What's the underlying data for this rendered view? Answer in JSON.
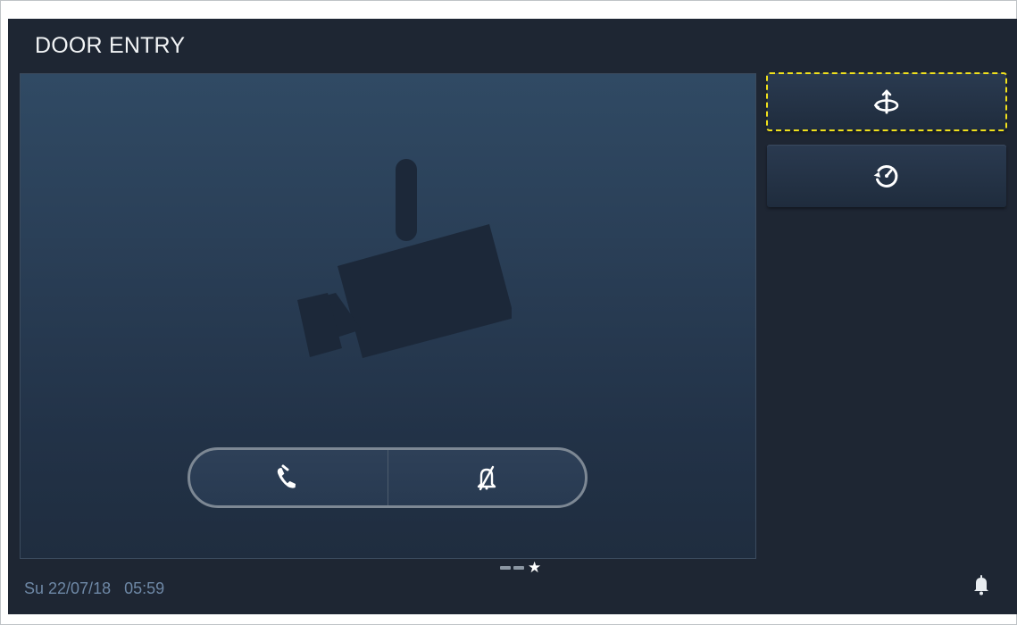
{
  "header": {
    "title": "DOOR ENTRY"
  },
  "video": {
    "state": "no-video",
    "placeholder_icon": "security-camera-icon"
  },
  "call_controls": {
    "accept_icon": "phone-handset-icon",
    "mute_icon": "bell-muted-icon"
  },
  "side_buttons": [
    {
      "icon": "rotate-view-icon",
      "focused": true
    },
    {
      "icon": "history-icon",
      "focused": false
    }
  ],
  "pager": {
    "pages": 3,
    "current_index": 2,
    "current_marker": "★"
  },
  "status_bar": {
    "datetime": "Su 22/07/18   05:59",
    "notification_icon": "bell-icon"
  },
  "colors": {
    "background": "#1e2633",
    "focus_outline": "#f1e11c",
    "datetime_text": "#6e88a6"
  }
}
